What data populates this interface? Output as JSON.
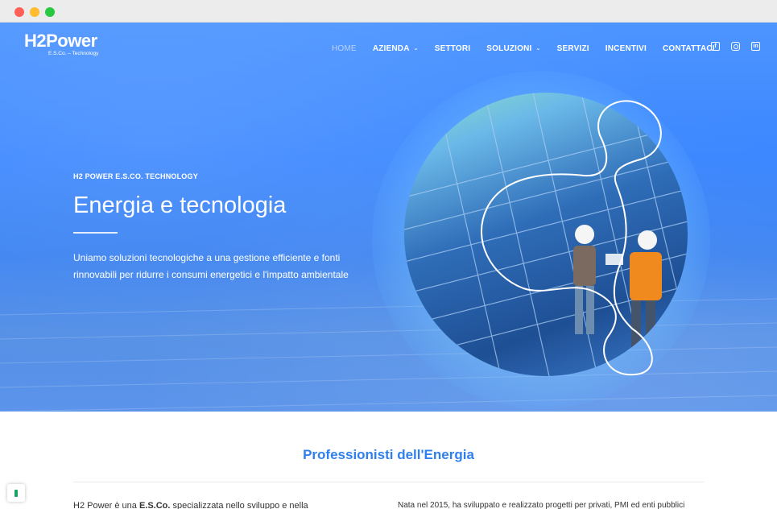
{
  "brand": {
    "logo_main": "H2Power",
    "logo_sub": "E.S.Co. – Technology"
  },
  "nav": {
    "items": [
      {
        "label": "HOME",
        "active": true,
        "dropdown": false
      },
      {
        "label": "AZIENDA",
        "active": false,
        "dropdown": true
      },
      {
        "label": "SETTORI",
        "active": false,
        "dropdown": false
      },
      {
        "label": "SOLUZIONI",
        "active": false,
        "dropdown": true
      },
      {
        "label": "SERVIZI",
        "active": false,
        "dropdown": false
      },
      {
        "label": "INCENTIVI",
        "active": false,
        "dropdown": false
      },
      {
        "label": "CONTATTACI",
        "active": false,
        "dropdown": false
      }
    ],
    "social": [
      "facebook-icon",
      "instagram-icon",
      "linkedin-icon"
    ]
  },
  "hero": {
    "eyebrow": "H2 POWER E.S.CO. TECHNOLOGY",
    "title": "Energia e tecnologia",
    "lead": "Uniamo soluzioni tecnologiche a una gestione efficiente e fonti rinnovabili per ridurre i consumi energetici e l'impatto ambientale"
  },
  "intro": {
    "title": "Professionisti dell'Energia",
    "left_prefix": "H2 Power è una ",
    "left_bold": "E.S.Co.",
    "left_suffix": " specializzata nello sviluppo e nella",
    "right_text": "Nata nel 2015, ha sviluppato e realizzato progetti per privati, PMI ed enti pubblici"
  },
  "colors": {
    "hero_blue": "#3a86ff",
    "accent": "#2f80ed"
  }
}
